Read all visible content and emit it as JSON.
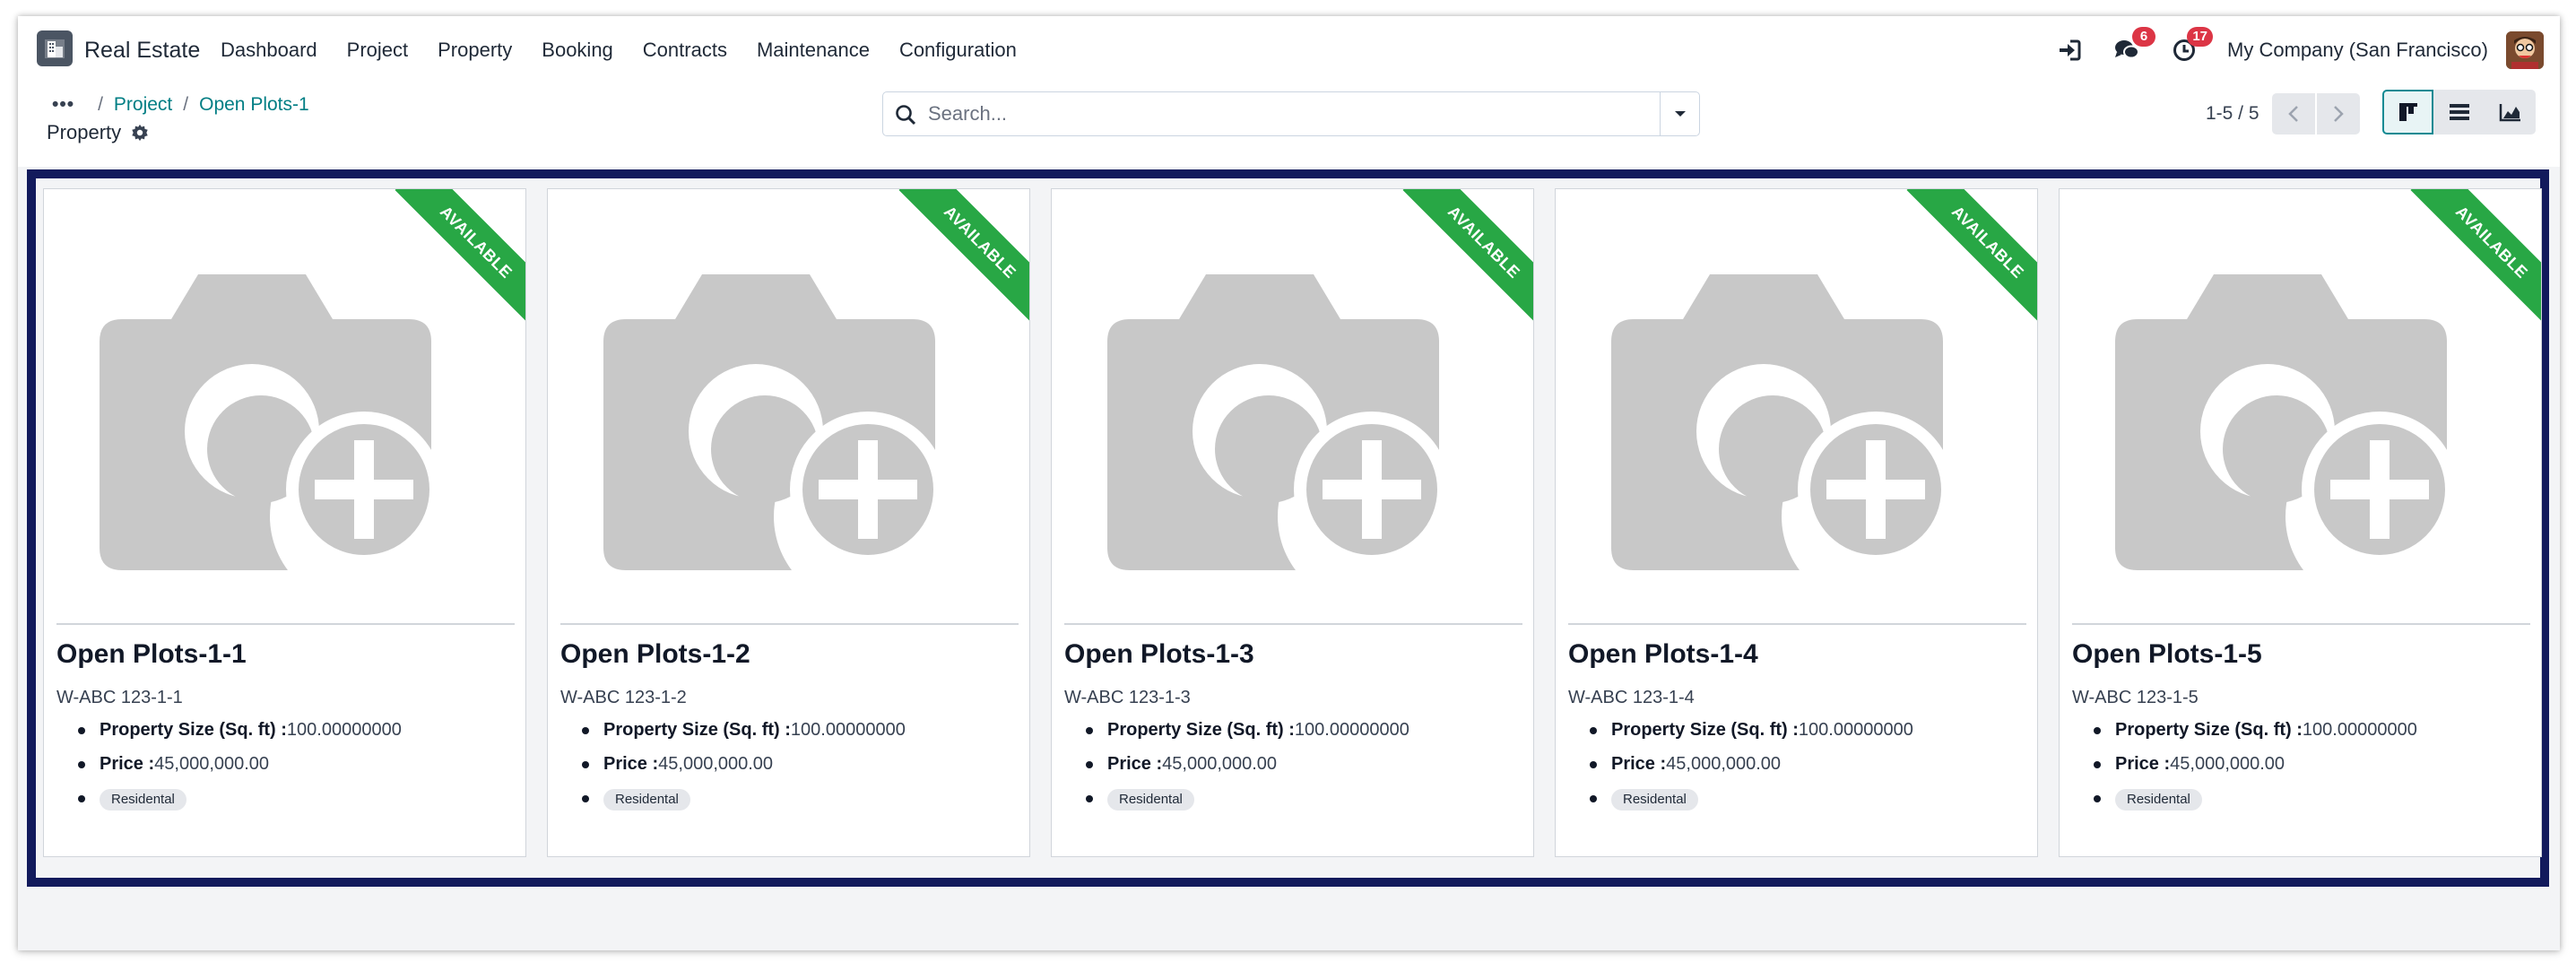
{
  "navbar": {
    "brand": "Real Estate",
    "menu": [
      "Dashboard",
      "Project",
      "Property",
      "Booking",
      "Contracts",
      "Maintenance",
      "Configuration"
    ],
    "messages_count": "6",
    "activities_count": "17",
    "company": "My Company (San Francisco)"
  },
  "breadcrumb": {
    "items": [
      "Project",
      "Open Plots-1"
    ],
    "current": "Property"
  },
  "search": {
    "placeholder": "Search..."
  },
  "pager": {
    "value": "1-5 / 5"
  },
  "colors": {
    "accent": "#017e84",
    "ribbon": "#28a745",
    "highlight_border": "#121a5c",
    "badge": "#dc3545"
  },
  "cards": [
    {
      "ribbon": "AVAILABLE",
      "title": "Open Plots-1-1",
      "ref": "W-ABC 123-1-1",
      "size_label": "Property Size (Sq. ft) :",
      "size_value": "100.00000000",
      "price_label": "Price :",
      "price_value": "45,000,000.00",
      "tag": "Residental"
    },
    {
      "ribbon": "AVAILABLE",
      "title": "Open Plots-1-2",
      "ref": "W-ABC 123-1-2",
      "size_label": "Property Size (Sq. ft) :",
      "size_value": "100.00000000",
      "price_label": "Price :",
      "price_value": "45,000,000.00",
      "tag": "Residental"
    },
    {
      "ribbon": "AVAILABLE",
      "title": "Open Plots-1-3",
      "ref": "W-ABC 123-1-3",
      "size_label": "Property Size (Sq. ft) :",
      "size_value": "100.00000000",
      "price_label": "Price :",
      "price_value": "45,000,000.00",
      "tag": "Residental"
    },
    {
      "ribbon": "AVAILABLE",
      "title": "Open Plots-1-4",
      "ref": "W-ABC 123-1-4",
      "size_label": "Property Size (Sq. ft) :",
      "size_value": "100.00000000",
      "price_label": "Price :",
      "price_value": "45,000,000.00",
      "tag": "Residental"
    },
    {
      "ribbon": "AVAILABLE",
      "title": "Open Plots-1-5",
      "ref": "W-ABC 123-1-5",
      "size_label": "Property Size (Sq. ft) :",
      "size_value": "100.00000000",
      "price_label": "Price :",
      "price_value": "45,000,000.00",
      "tag": "Residental"
    }
  ]
}
